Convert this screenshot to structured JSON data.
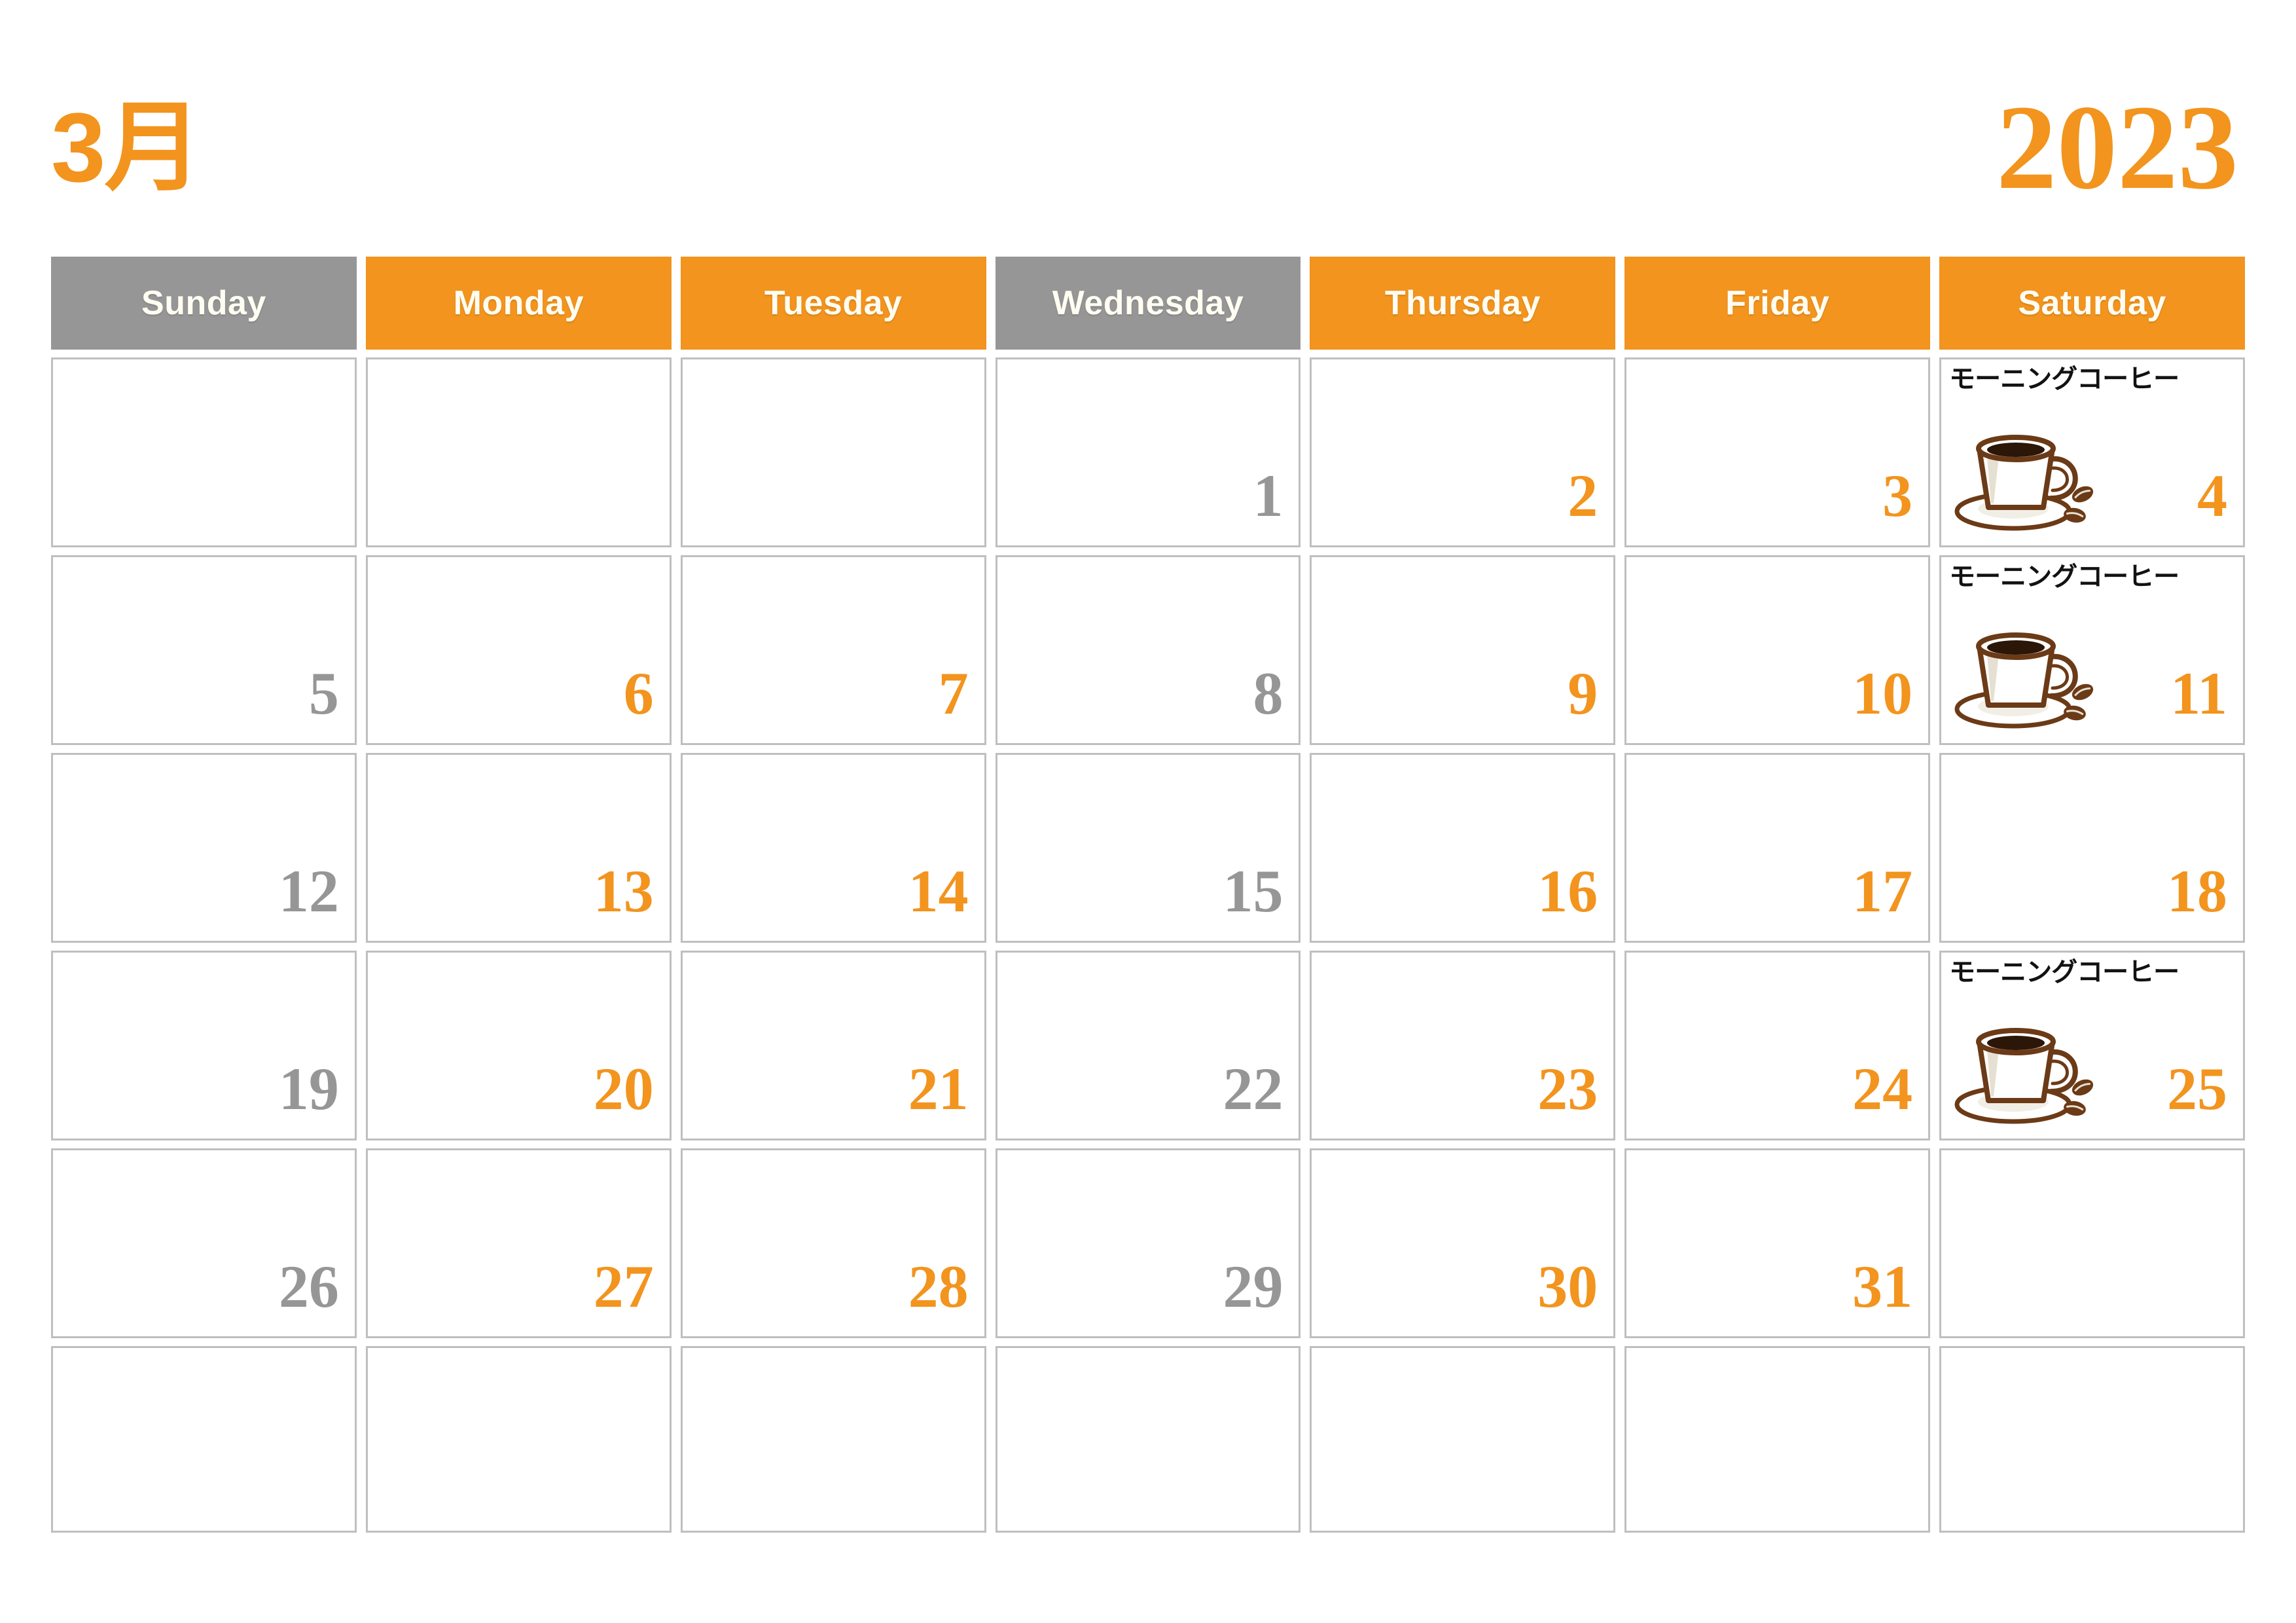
{
  "header": {
    "month_label": "3月",
    "year_label": "2023"
  },
  "colors": {
    "accent_orange": "#F2941E",
    "muted_gray": "#969696",
    "cell_border": "#BFBFBF",
    "header_text": "#FFFDF2",
    "event_text": "#121212",
    "coffee_outline": "#6B3A16",
    "coffee_liquid": "#2B1608",
    "cup_fill": "#FFFFFF",
    "cup_shade": "#E6E0D2",
    "page_background": "#FFFFFF"
  },
  "weekday_headers": [
    {
      "label": "Sunday",
      "style": "gray",
      "icon": "none"
    },
    {
      "label": "Monday",
      "style": "orange",
      "icon": "none"
    },
    {
      "label": "Tuesday",
      "style": "orange",
      "icon": "none"
    },
    {
      "label": "Wednesday",
      "style": "gray",
      "icon": "none"
    },
    {
      "label": "Thursday",
      "style": "orange",
      "icon": "none"
    },
    {
      "label": "Friday",
      "style": "orange",
      "icon": "none"
    },
    {
      "label": "Saturday",
      "style": "orange",
      "icon": "none"
    }
  ],
  "weeks": [
    [
      {
        "day": "",
        "style": ""
      },
      {
        "day": "",
        "style": ""
      },
      {
        "day": "",
        "style": ""
      },
      {
        "day": "1",
        "style": "gray"
      },
      {
        "day": "2",
        "style": "orange"
      },
      {
        "day": "3",
        "style": "orange"
      },
      {
        "day": "4",
        "style": "orange",
        "event": {
          "label": "モーニングコーヒー",
          "icon": "coffee-cup-icon"
        }
      }
    ],
    [
      {
        "day": "5",
        "style": "gray"
      },
      {
        "day": "6",
        "style": "orange"
      },
      {
        "day": "7",
        "style": "orange"
      },
      {
        "day": "8",
        "style": "gray"
      },
      {
        "day": "9",
        "style": "orange"
      },
      {
        "day": "10",
        "style": "orange"
      },
      {
        "day": "11",
        "style": "orange",
        "event": {
          "label": "モーニングコーヒー",
          "icon": "coffee-cup-icon"
        }
      }
    ],
    [
      {
        "day": "12",
        "style": "gray"
      },
      {
        "day": "13",
        "style": "orange"
      },
      {
        "day": "14",
        "style": "orange"
      },
      {
        "day": "15",
        "style": "gray"
      },
      {
        "day": "16",
        "style": "orange"
      },
      {
        "day": "17",
        "style": "orange"
      },
      {
        "day": "18",
        "style": "orange"
      }
    ],
    [
      {
        "day": "19",
        "style": "gray"
      },
      {
        "day": "20",
        "style": "orange"
      },
      {
        "day": "21",
        "style": "orange"
      },
      {
        "day": "22",
        "style": "gray"
      },
      {
        "day": "23",
        "style": "orange"
      },
      {
        "day": "24",
        "style": "orange"
      },
      {
        "day": "25",
        "style": "orange",
        "event": {
          "label": "モーニングコーヒー",
          "icon": "coffee-cup-icon"
        }
      }
    ],
    [
      {
        "day": "26",
        "style": "gray"
      },
      {
        "day": "27",
        "style": "orange"
      },
      {
        "day": "28",
        "style": "orange"
      },
      {
        "day": "29",
        "style": "gray"
      },
      {
        "day": "30",
        "style": "orange"
      },
      {
        "day": "31",
        "style": "orange"
      },
      {
        "day": "",
        "style": ""
      }
    ],
    [
      {
        "day": "",
        "style": ""
      },
      {
        "day": "",
        "style": ""
      },
      {
        "day": "",
        "style": ""
      },
      {
        "day": "",
        "style": ""
      },
      {
        "day": "",
        "style": ""
      },
      {
        "day": "",
        "style": ""
      },
      {
        "day": "",
        "style": ""
      }
    ]
  ]
}
